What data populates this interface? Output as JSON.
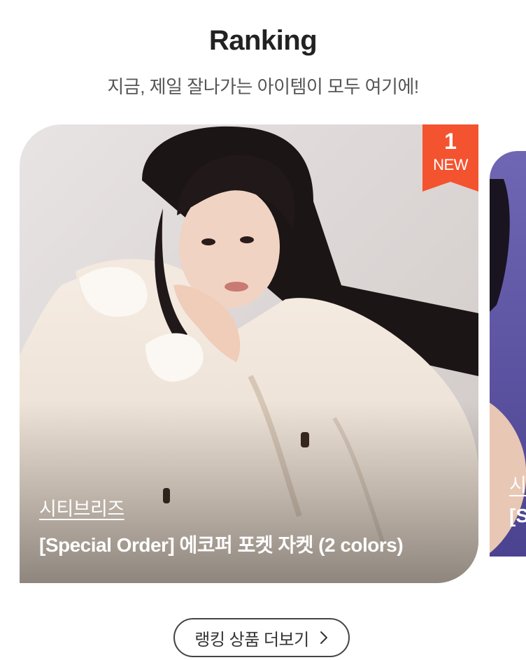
{
  "section": {
    "title": "Ranking",
    "subtitle": "지금, 제일 잘나가는 아이템이 모두 여기에!"
  },
  "cards": [
    {
      "rank": "1",
      "rank_tag": "NEW",
      "brand": "시티브리즈",
      "name": "[Special Order] 에코퍼 포켓 자켓 (2 colors)",
      "image_desc": "model-in-cream-faux-fur-jacket"
    },
    {
      "brand_partial": "시",
      "name_partial": "[S"
    }
  ],
  "more_button": {
    "label": "랭킹 상품 더보기",
    "icon": "chevron-right-icon"
  },
  "colors": {
    "badge": "#f4532f",
    "title": "#222222",
    "subtitle": "#555555",
    "button_border": "#444444"
  }
}
